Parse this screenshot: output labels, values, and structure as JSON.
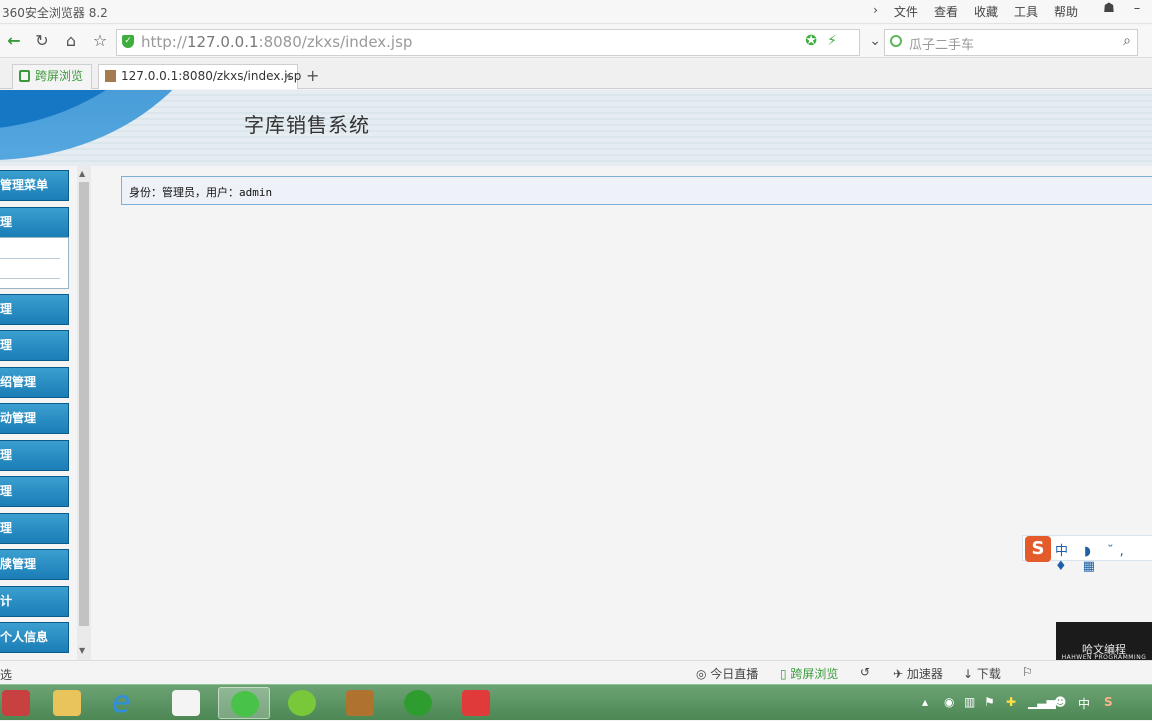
{
  "browser": {
    "title": "360安全浏览器 8.2",
    "menu": [
      "文件",
      "查看",
      "收藏",
      "工具",
      "帮助"
    ],
    "url_host": "127.0.0.1",
    "url_rest": ":8080/zkxs/index.jsp",
    "url_scheme": "http://",
    "search_placeholder": "瓜子二手车",
    "tabs": [
      {
        "label": "跨屏浏览",
        "active": false
      },
      {
        "label": "127.0.0.1:8080/zkxs/index.jsp",
        "active": true
      }
    ],
    "new_tab": "+"
  },
  "page": {
    "system_title": "字库销售系统",
    "identity_text": "身份：管理员，用户：admin",
    "sidebar": [
      {
        "label": "管理菜单"
      },
      {
        "label": "理"
      },
      {
        "label": "理"
      },
      {
        "label": "理"
      },
      {
        "label": "绍管理"
      },
      {
        "label": "动管理"
      },
      {
        "label": "理"
      },
      {
        "label": "理"
      },
      {
        "label": "理"
      },
      {
        "label": "牍管理"
      },
      {
        "label": "计"
      },
      {
        "label": "个人信息"
      }
    ]
  },
  "ime": {
    "logo": "S",
    "items": "中 ◗ ˘, ♦ ▦"
  },
  "watermark": {
    "line1": "哈文编程",
    "line2": "HAHWEN PROGRAMMING"
  },
  "statusbar": {
    "left": "选",
    "items": [
      "今日直播",
      "跨屏浏览",
      "加速器",
      "下载"
    ]
  },
  "tray": {
    "ime": "中",
    "sogou": "S"
  },
  "colors": {
    "accent": "#1b7db6",
    "header_bg": "#e5edf2",
    "taskbar": "#4c8754"
  }
}
